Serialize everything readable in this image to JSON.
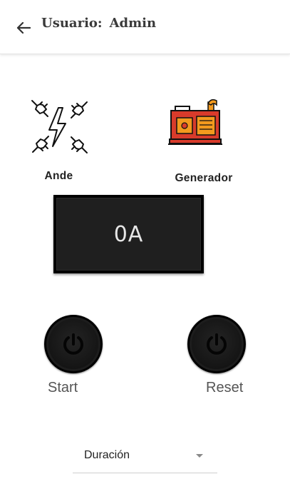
{
  "header": {
    "user_label": "Usuario:",
    "user_name": "Admin"
  },
  "sources": {
    "ande": {
      "label": "Ande",
      "icon": "power-plugs-lightning-icon"
    },
    "generador": {
      "label": "Generador",
      "icon": "generator-icon"
    }
  },
  "display": {
    "current": "0A"
  },
  "controls": {
    "start": {
      "label": "Start",
      "icon": "power-icon"
    },
    "reset": {
      "label": "Reset",
      "icon": "power-icon"
    }
  },
  "duration_select": {
    "value": "Duración"
  },
  "colors": {
    "generator_red": "#d83b2b",
    "generator_orange": "#f39a1e",
    "display_bg": "#1f1f1f",
    "display_text": "#e6e6e6"
  }
}
